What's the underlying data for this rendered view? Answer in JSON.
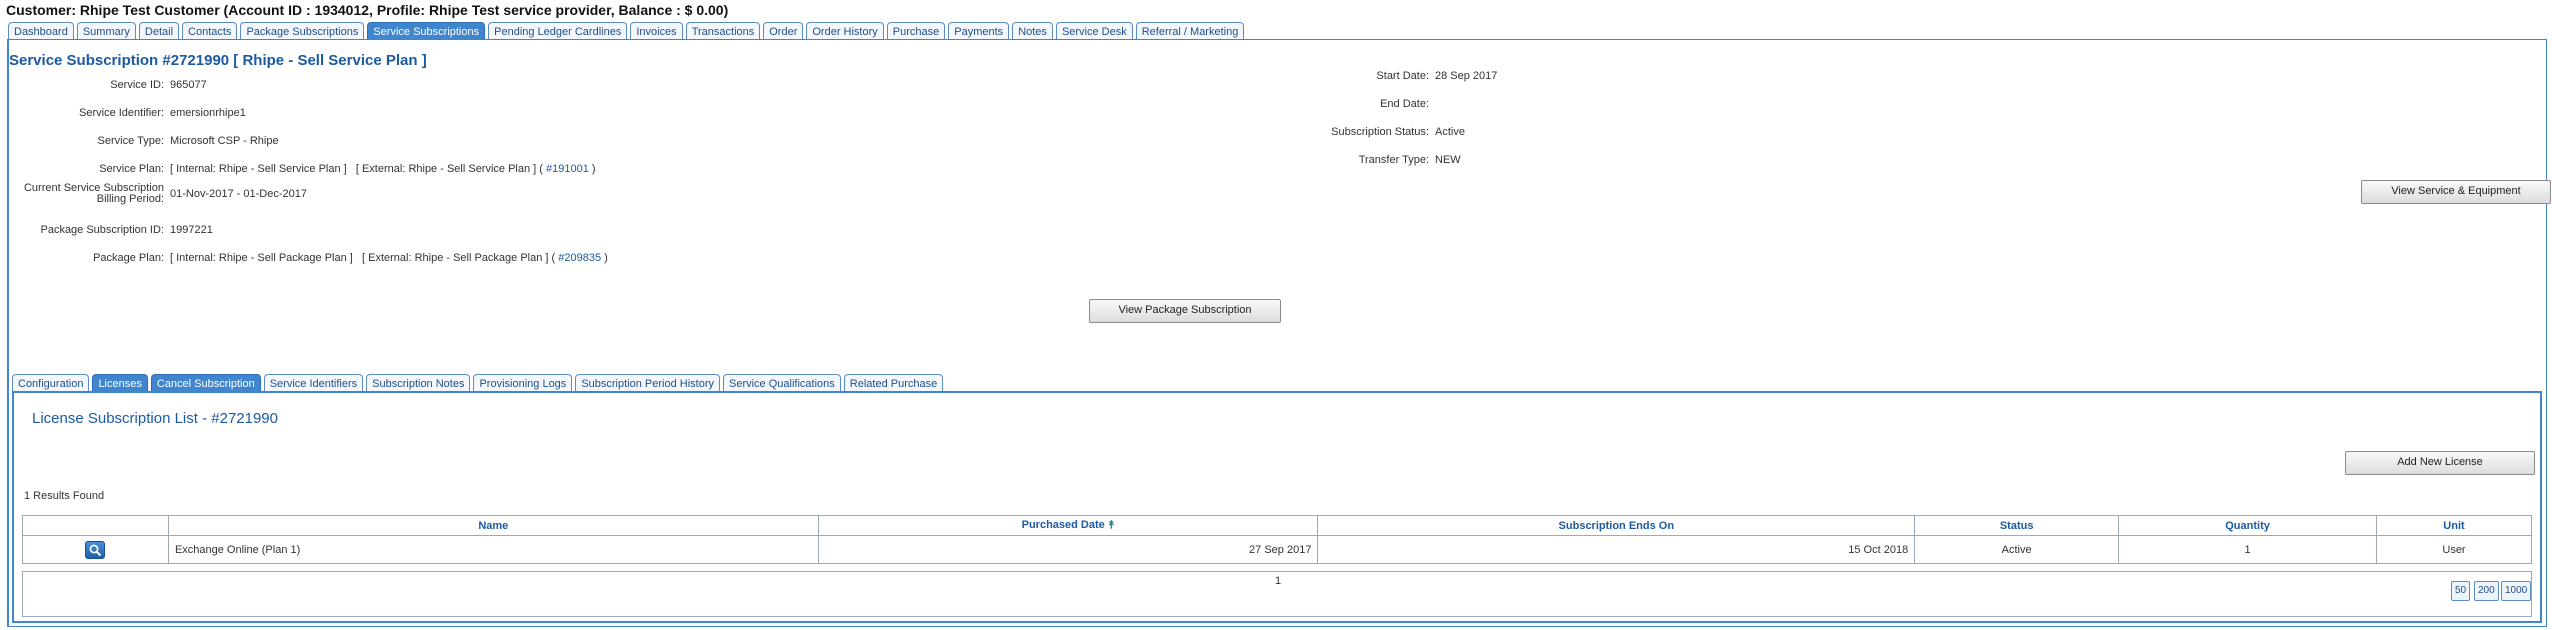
{
  "header": {
    "customer_line": "Customer: Rhipe Test Customer (Account ID : 1934012, Profile: Rhipe Test service provider, Balance : $ 0.00)"
  },
  "top_tabs": [
    {
      "label": "Dashboard"
    },
    {
      "label": "Summary"
    },
    {
      "label": "Detail"
    },
    {
      "label": "Contacts"
    },
    {
      "label": "Package Subscriptions"
    },
    {
      "label": "Service Subscriptions",
      "active": true
    },
    {
      "label": "Pending Ledger Cardlines"
    },
    {
      "label": "Invoices"
    },
    {
      "label": "Transactions"
    },
    {
      "label": "Order"
    },
    {
      "label": "Order History"
    },
    {
      "label": "Purchase"
    },
    {
      "label": "Payments"
    },
    {
      "label": "Notes"
    },
    {
      "label": "Service Desk"
    },
    {
      "label": "Referral / Marketing"
    }
  ],
  "subscription": {
    "title": "Service Subscription #2721990 [ Rhipe - Sell Service Plan ]",
    "left_fields": [
      {
        "label": "Service ID:",
        "value": "965077"
      },
      {
        "label": "Service Identifier:",
        "value": "emersionrhipe1"
      },
      {
        "label": "Service Type:",
        "value": "Microsoft CSP - Rhipe"
      },
      {
        "label": "Service Plan:",
        "value": "[ Internal: Rhipe - Sell Service Plan ]   [ External: Rhipe - Sell Service Plan ] ( ",
        "link": "#191001",
        "suffix": " )"
      },
      {
        "label_line1": "Current Service Subscription",
        "label_line2": "Billing Period:",
        "value": "01-Nov-2017 - 01-Dec-2017"
      },
      {
        "label": "Package Subscription ID:",
        "value": "1997221"
      },
      {
        "label": "Package Plan:",
        "value": "[ Internal: Rhipe - Sell Package Plan ]   [ External: Rhipe - Sell Package Plan ] ( ",
        "link": "#209835",
        "suffix": " )"
      }
    ],
    "right_fields": [
      {
        "label": "Start Date:",
        "value": "28 Sep 2017"
      },
      {
        "label": "End Date:",
        "value": ""
      },
      {
        "label": "Subscription Status:",
        "value": "Active"
      },
      {
        "label": "Transfer Type:",
        "value": "NEW"
      }
    ],
    "view_service_button": "View Service & Equipment",
    "view_package_button": "View Package Subscription"
  },
  "sub_tabs": [
    {
      "label": "Configuration"
    },
    {
      "label": "Licenses",
      "active": true
    },
    {
      "label": "Cancel Subscription",
      "active": true
    },
    {
      "label": "Service Identifiers"
    },
    {
      "label": "Subscription Notes"
    },
    {
      "label": "Provisioning Logs"
    },
    {
      "label": "Subscription Period History"
    },
    {
      "label": "Service Qualifications"
    },
    {
      "label": "Related Purchase"
    }
  ],
  "licenses": {
    "title": "License Subscription List - #2721990",
    "add_button": "Add New License",
    "results_text": "1 Results Found",
    "columns": [
      "Name",
      "Purchased Date",
      "Subscription Ends On",
      "Status",
      "Quantity",
      "Unit"
    ],
    "rows": [
      {
        "name": "Exchange Online (Plan 1)",
        "purchased": "27 Sep 2017",
        "ends": "15 Oct 2018",
        "status": "Active",
        "quantity": "1",
        "unit": "User"
      }
    ],
    "page_number": "1",
    "page_sizes": [
      "50",
      "200",
      "1000"
    ]
  },
  "colors": {
    "accent": "#3f86cf",
    "title": "#1c5aa5"
  },
  "icons": {
    "view_row": "magnifier-icon",
    "sort": "sort-ascending-icon"
  }
}
